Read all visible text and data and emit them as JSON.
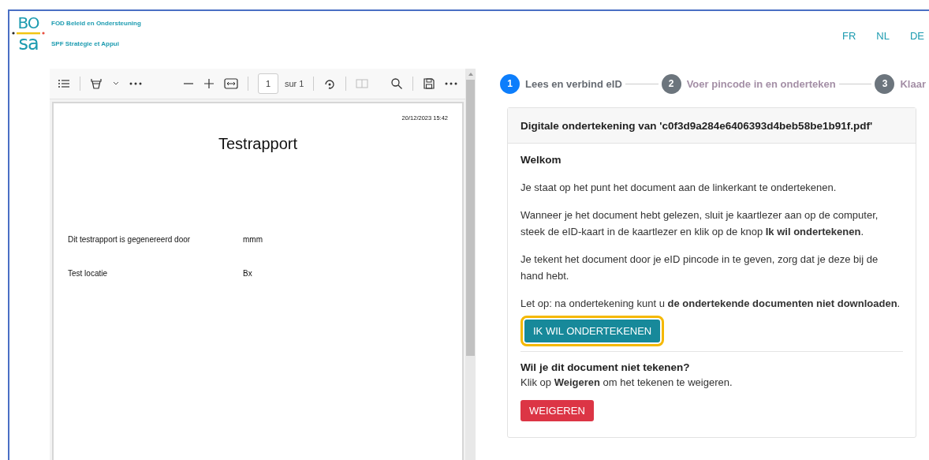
{
  "logo": {
    "top": "BO",
    "bottom": "sa",
    "lines": [
      "FOD Beleid en Ondersteuning",
      "SPF Stratégie et Appui"
    ]
  },
  "languages": [
    {
      "label": "FR",
      "selected": false
    },
    {
      "label": "NL",
      "selected": false
    },
    {
      "label": "DE",
      "selected": false
    }
  ],
  "viewer": {
    "page_input": "1",
    "page_total": "sur 1",
    "document": {
      "date": "20/12/2023 15:42",
      "title": "Testrapport",
      "rows": [
        {
          "label": "Dit testrapport is gegenereerd door",
          "value": "mmm"
        },
        {
          "label": "Test locatie",
          "value": "Bx"
        }
      ]
    }
  },
  "steps": [
    {
      "number": "1",
      "label": "Lees en verbind eID",
      "selected": true
    },
    {
      "number": "2",
      "label": "Voer pincode in en onderteken",
      "selected": false
    },
    {
      "number": "3",
      "label": "Klaar",
      "selected": false
    }
  ],
  "card": {
    "title": "Digitale ondertekening van 'c0f3d9a284e6406393d4beb58be1b91f.pdf'",
    "heading": "Welkom",
    "paragraphs": [
      "Je staat op het punt het document aan de linkerkant te ondertekenen.",
      "Wanneer je het document hebt gelezen, sluit je kaartlezer aan op de computer, steek de eID-kaart in de kaartlezer en klik op de knop **Ik wil ondertekenen**.",
      "Je tekent het document door je eID pincode in te geven, zorg dat je deze bij de hand hebt.",
      "Let op: na ondertekening kunt u **de ondertekende documenten niet downloaden**."
    ],
    "sign_button": {
      "label": "IK WIL ONDERTEKENEN",
      "highlighted": true
    },
    "refuse_heading": "Wil je dit document niet tekenen?",
    "refuse_text": "Klik op **Weigeren** om het tekenen te weigeren.",
    "refuse_button": {
      "label": "WEIGEREN"
    }
  }
}
